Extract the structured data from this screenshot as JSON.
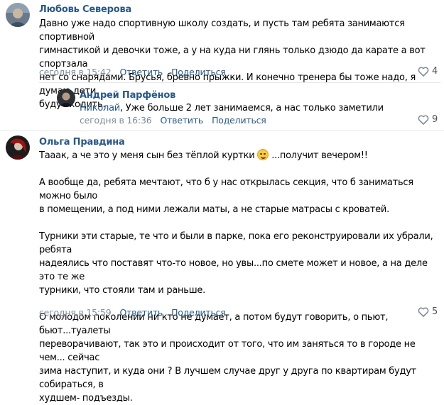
{
  "comments": [
    {
      "author": "Любовь Северова",
      "text_lines": [
        "Давно уже надо спортивную школу создать, и пусть там ребята занимаются спортивной",
        "гимнастикой и девочки тоже, а у на куда ни глянь только дзюдо да карате а вот спортзала",
        "нет со снарядами. Брусья, бревно прыжки. И конечно тренера бы тоже надо, я думаю дети",
        "будут ходить."
      ],
      "time": "сегодня в 15:42",
      "reply_label": "Ответить",
      "share_label": "Поделиться",
      "likes": "4"
    },
    {
      "author": "Андрей Парфёнов",
      "reply_to": "Николай",
      "text": ", Уже больше 2 лет занимаемся, а нас только заметили",
      "time": "сегодня в 16:36",
      "reply_label": "Ответить",
      "share_label": "Поделиться",
      "likes": "9"
    },
    {
      "author": "Ольга Правдина",
      "line1_a": "Тааак, а че это у меня сын без тёплой куртки",
      "line1_b": " ...получит вечером!!",
      "para2": [
        "А вообще да, ребята мечтают, что б у нас открылась секция, что б заниматься можно было",
        "в помещении, а под ними лежали маты, а не старые матрасы с кроватей."
      ],
      "para3": [
        "Турники эти старые, те что и были в парке, пока его реконструировали их убрали, ребята",
        "надеялись что поставят что-то новое, но увы...по смете может и новое, а на деле это те же",
        "турники, что стояли там и раньше."
      ],
      "para4": [
        "О молодом поколении ни кто не думает, а потом будут говорить, о пьют, бьют...туалеты",
        "переворачивают, так это и происходит от того, что им заняться то в городе не чем... сейчас",
        "зима наступит, и куда они ? В лучшем случае друг у друга по квартирам будут собираться, в",
        "худшем- подъезды."
      ],
      "time": "сегодня в 15:59",
      "reply_label": "Ответить",
      "share_label": "Поделиться",
      "likes": "5"
    }
  ],
  "colors": {
    "link": "#2a5885",
    "meta": "#818c99",
    "divider": "#e7e8ec"
  },
  "icons": {
    "like": "heart-outline-icon",
    "emoji": "grinning-sweat-emoji"
  }
}
